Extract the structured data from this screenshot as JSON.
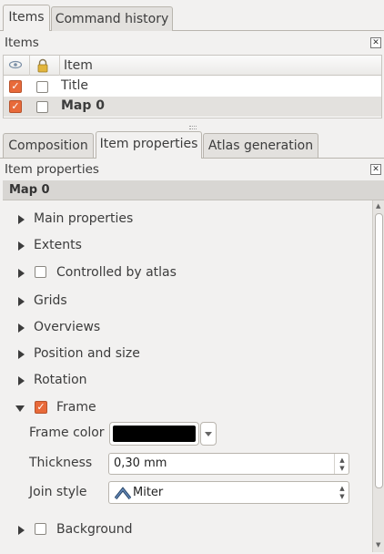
{
  "top_tabs": [
    {
      "label": "Items"
    },
    {
      "label": "Command history"
    }
  ],
  "items_panel": {
    "title": "Items",
    "columns": {
      "visible_icon": "eye-icon",
      "lock_icon": "lock-icon",
      "item": "Item"
    },
    "rows": [
      {
        "visible": true,
        "locked": false,
        "name": "Title"
      },
      {
        "visible": true,
        "locked": false,
        "name": "Map 0"
      }
    ]
  },
  "sub_tabs": [
    {
      "label": "Composition"
    },
    {
      "label": "Item properties"
    },
    {
      "label": "Atlas generation"
    }
  ],
  "properties_panel": {
    "title": "Item properties",
    "item_name": "Map 0",
    "groups": {
      "main_properties": "Main properties",
      "extents": "Extents",
      "controlled_by_atlas": "Controlled by atlas",
      "grids": "Grids",
      "overviews": "Overviews",
      "position_and_size": "Position and size",
      "rotation": "Rotation",
      "frame": "Frame",
      "background": "Background"
    },
    "frame": {
      "enabled": true,
      "color_label": "Frame color",
      "color_value": "#000000",
      "thickness_label": "Thickness",
      "thickness_value": "0,30 mm",
      "join_label": "Join style",
      "join_value": "Miter"
    }
  },
  "colors": {
    "accent_check": "#e86a3a"
  }
}
